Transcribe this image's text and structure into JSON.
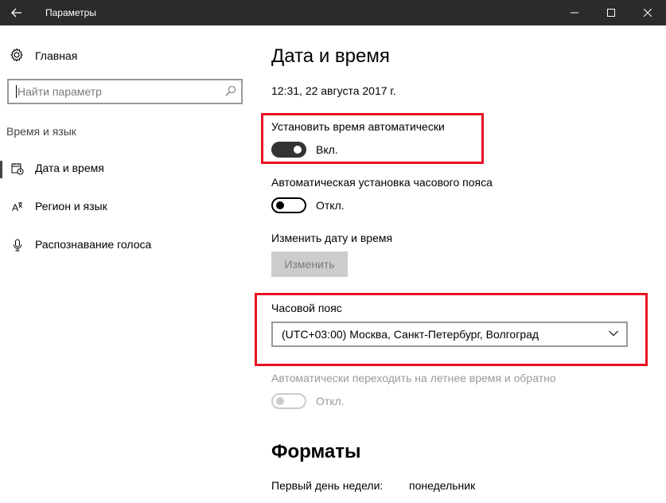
{
  "window": {
    "title": "Параметры",
    "back_icon": "back-arrow-icon",
    "min_icon": "minimize-icon",
    "max_icon": "maximize-icon",
    "close_icon": "close-icon"
  },
  "sidebar": {
    "home_label": "Главная",
    "search_placeholder": "Найти параметр",
    "section_title": "Время и язык",
    "items": [
      {
        "label": "Дата и время",
        "icon": "calendar-clock-icon",
        "active": true
      },
      {
        "label": "Регион и язык",
        "icon": "language-icon",
        "active": false
      },
      {
        "label": "Распознавание голоса",
        "icon": "microphone-icon",
        "active": false
      }
    ]
  },
  "main": {
    "title": "Дата и время",
    "current_datetime": "12:31, 22 августа 2017 г.",
    "auto_time": {
      "label": "Установить время автоматически",
      "state": "Вкл."
    },
    "auto_timezone": {
      "label": "Автоматическая установка часового пояса",
      "state": "Откл."
    },
    "change_datetime": {
      "label": "Изменить дату и время",
      "button": "Изменить"
    },
    "timezone": {
      "label": "Часовой пояс",
      "value": "(UTC+03:00) Москва, Санкт-Петербург, Волгоград"
    },
    "dst": {
      "label": "Автоматически переходить на летнее время и обратно",
      "state": "Откл."
    },
    "formats": {
      "title": "Форматы",
      "first_day_label": "Первый день недели:",
      "first_day_value": "понедельник"
    }
  },
  "colors": {
    "titlebar": "#2b2b2b",
    "highlight": "#e81123",
    "toggle_on": "#333333",
    "disabled": "#999999"
  }
}
